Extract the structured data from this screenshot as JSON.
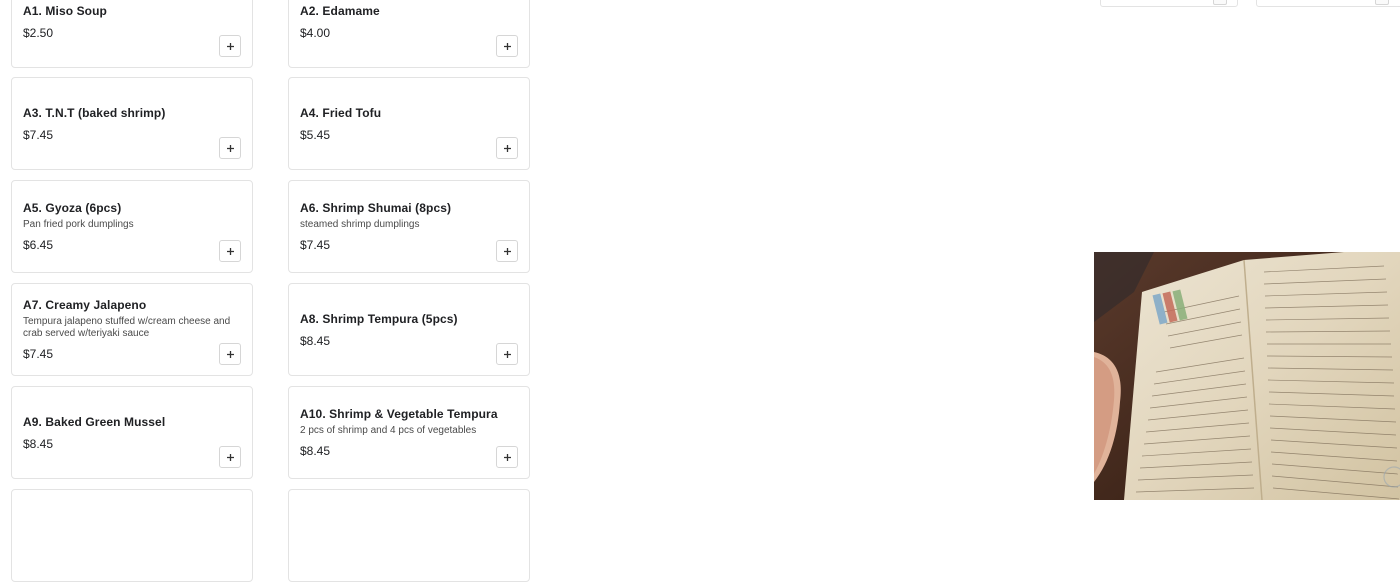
{
  "menu": {
    "items": [
      {
        "name": "A1. Miso Soup",
        "description": "",
        "price": "$2.50"
      },
      {
        "name": "A2. Edamame",
        "description": "",
        "price": "$4.00"
      },
      {
        "name": "A3. T.N.T (baked shrimp)",
        "description": "",
        "price": "$7.45"
      },
      {
        "name": "A4. Fried Tofu",
        "description": "",
        "price": "$5.45"
      },
      {
        "name": "A5. Gyoza (6pcs)",
        "description": "Pan fried pork dumplings",
        "price": "$6.45"
      },
      {
        "name": "A6. Shrimp Shumai (8pcs)",
        "description": "steamed shrimp dumplings",
        "price": "$7.45"
      },
      {
        "name": "A7. Creamy Jalapeno",
        "description": "Tempura jalapeno stuffed w/cream cheese and crab served w/teriyaki sauce",
        "price": "$7.45"
      },
      {
        "name": "A8. Shrimp Tempura (5pcs)",
        "description": "",
        "price": "$8.45"
      },
      {
        "name": "A9. Baked Green Mussel",
        "description": "",
        "price": "$8.45"
      },
      {
        "name": "A10. Shrimp & Vegetable Tempura",
        "description": "2 pcs of shrimp and 4 pcs of vegetables",
        "price": "$8.45"
      }
    ]
  },
  "icons": {
    "add": "plus-icon"
  },
  "colors": {
    "card_border": "#e3e3e3",
    "text": "#202124"
  }
}
